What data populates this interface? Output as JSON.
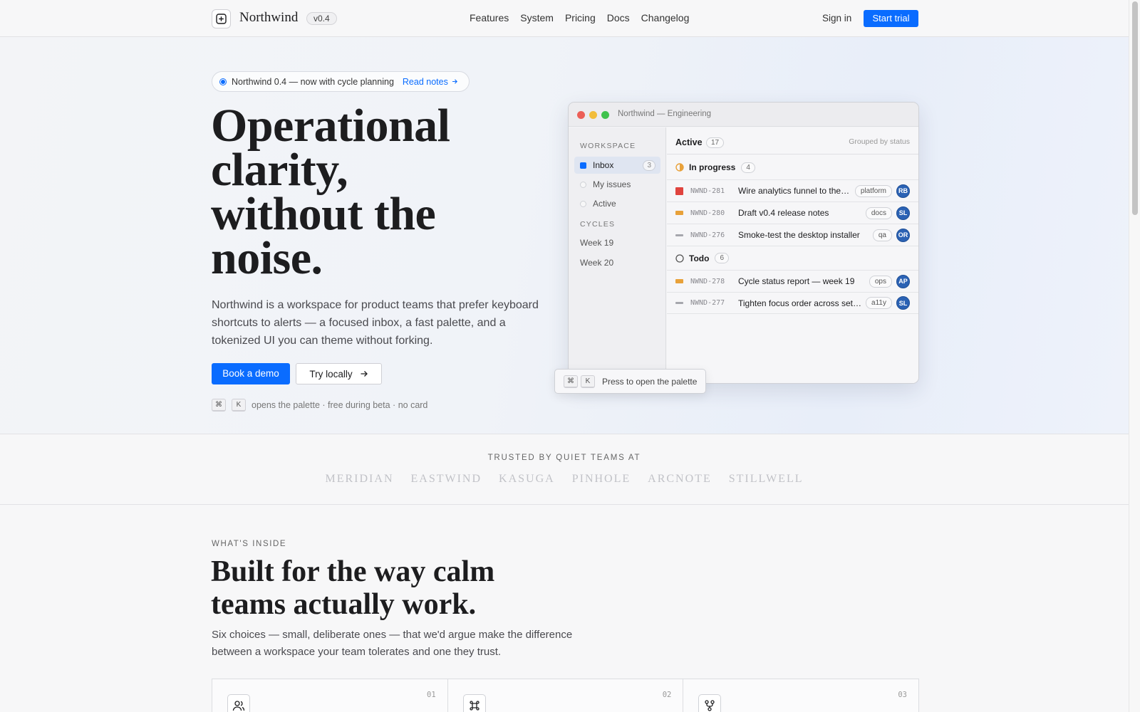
{
  "header": {
    "brand": "Northwind",
    "version": "v0.4",
    "nav": [
      "Features",
      "System",
      "Pricing",
      "Docs",
      "Changelog"
    ],
    "sign_in": "Sign in",
    "start_trial": "Start trial"
  },
  "hero": {
    "announce_text": "Northwind 0.4 — now with cycle planning",
    "announce_link": "Read notes",
    "title_lines": [
      "Operational",
      "clarity,",
      "without the",
      "noise."
    ],
    "lead": "Northwind is a workspace for product teams that prefer keyboard shortcuts to alerts — a focused inbox, a fast palette, and a tokenized UI you can theme without forking.",
    "cta_primary": "Book a demo",
    "cta_secondary": "Try locally",
    "hint_keys": [
      "⌘",
      "K"
    ],
    "hint_text": "opens the palette · free during beta · no card"
  },
  "app": {
    "window_title": "Northwind — Engineering",
    "sidebar": {
      "workspace_label": "WORKSPACE",
      "items": [
        {
          "label": "Inbox",
          "count": "3"
        },
        {
          "label": "My issues"
        },
        {
          "label": "Active"
        }
      ],
      "cycles_label": "CYCLES",
      "cycles": [
        "Week 19",
        "Week 20"
      ]
    },
    "main": {
      "title": "Active",
      "count": "17",
      "grouping": "Grouped by status",
      "groups": [
        {
          "label": "In progress",
          "count": "4",
          "issues": [
            {
              "key": "NWND-281",
              "title": "Wire analytics funnel to the new dashboard",
              "tag": "platform",
              "assignee": "RB",
              "priority": "urgent"
            },
            {
              "key": "NWND-280",
              "title": "Draft v0.4 release notes",
              "tag": "docs",
              "assignee": "SL",
              "priority": "high"
            },
            {
              "key": "NWND-276",
              "title": "Smoke-test the desktop installer",
              "tag": "qa",
              "assignee": "OR",
              "priority": "low"
            }
          ]
        },
        {
          "label": "Todo",
          "count": "6",
          "issues": [
            {
              "key": "NWND-278",
              "title": "Cycle status report — week 19",
              "tag": "ops",
              "assignee": "AP",
              "priority": "high"
            },
            {
              "key": "NWND-277",
              "title": "Tighten focus order across settings",
              "tag": "a11y",
              "assignee": "SL",
              "priority": "low"
            }
          ]
        }
      ]
    },
    "palette_keys": [
      "⌘",
      "K"
    ],
    "palette_text": "Press to open the palette"
  },
  "trusted": {
    "label": "TRUSTED BY QUIET TEAMS AT",
    "logos": [
      "MERIDIAN",
      "EASTWIND",
      "KASUGA",
      "PINHOLE",
      "ARCNOTE",
      "STILLWELL"
    ]
  },
  "features": {
    "kicker": "WHAT'S INSIDE",
    "title_lines": [
      "Built for the way calm",
      "teams actually work."
    ],
    "subtitle": "Six choices — small, deliberate ones — that we'd argue make the difference between a workspace your team tolerates and one they trust.",
    "cards": [
      {
        "num": "01",
        "icon": "users-icon"
      },
      {
        "num": "02",
        "icon": "command-icon"
      },
      {
        "num": "03",
        "icon": "branch-icon"
      }
    ]
  },
  "colors": {
    "accent": "#0a6cff",
    "urgent": "#e0443e",
    "high": "#e8a13a",
    "low": "#a6a7ad",
    "avatar": "#2b62b4"
  }
}
